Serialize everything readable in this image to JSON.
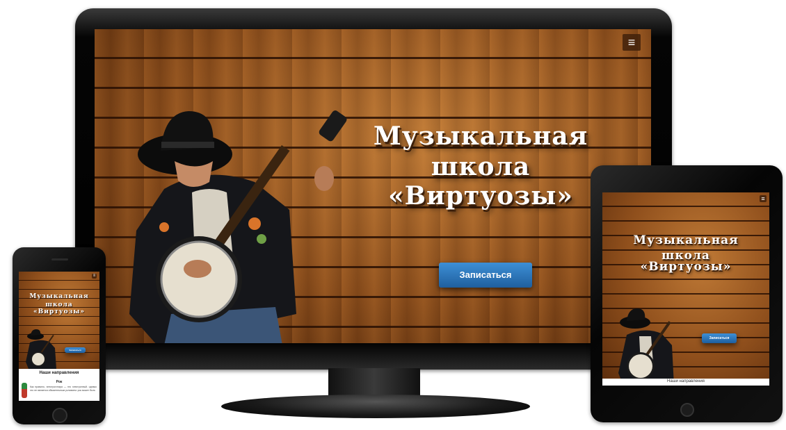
{
  "desktop": {
    "title_line1": "Музыкальная школа",
    "title_line2": "«Виртуозы»",
    "cta_label": "Записаться",
    "menu_glyph": "≡"
  },
  "tablet": {
    "title_line1": "Музыкальная школа",
    "title_line2": "«Виртуозы»",
    "cta_label": "Записаться",
    "section_heading": "Наши направления",
    "menu_glyph": "≡"
  },
  "phone": {
    "title_line1": "Музыкальная школа",
    "title_line2": "«Виртуозы»",
    "cta_label": "Записаться",
    "section_heading": "Наши направления",
    "item_title": "Рок",
    "item_text": "Как правило, электрогитара — это электронный. однако это не является обязательным условием: рок может быть",
    "menu_glyph": "≡"
  },
  "colors": {
    "cta": "#2a74bd",
    "bezel": "#0d0d0d",
    "wood": "#9a5a22"
  }
}
